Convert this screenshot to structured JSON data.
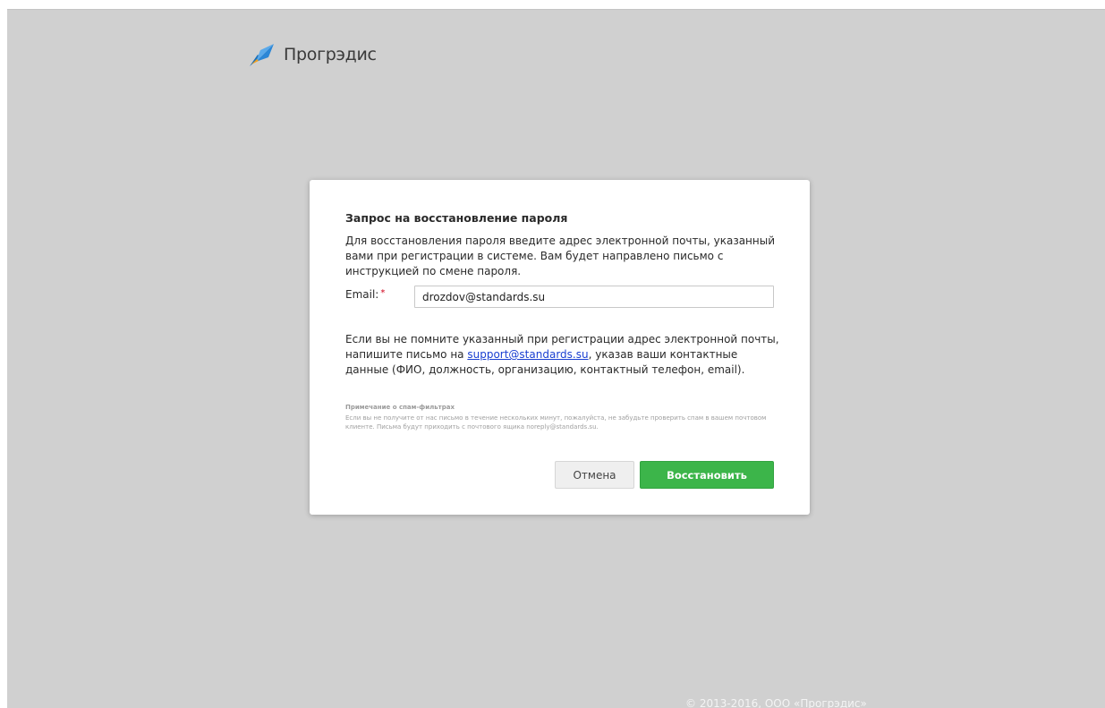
{
  "header": {
    "logo_text": "Прогрэдис"
  },
  "dialog": {
    "title": "Запрос на восстановление пароля",
    "description": "Для восстановления пароля введите адрес электронной почты, указанный вами при регистрации в системе. Вам будет направлено письмо с инструкцией по смене пароля.",
    "email_label": "Email:",
    "required_mark": "*",
    "email_value": "drozdov@standards.su",
    "help_prefix": "Если вы не помните указанный при регистрации адрес электронной почты, напишите письмо на ",
    "help_link": "support@standards.su",
    "help_suffix": ", указав ваши контактные данные (ФИО, должность, организацию, контактный телефон, email).",
    "spam_title": "Примечание о спам-фильтрах",
    "spam_text": "Если вы не получите от нас письмо в течение нескольких минут, пожалуйста, не забудьте проверить спам в вашем почтовом клиенте. Письма будут приходить с почтового ящика noreply@standards.su.",
    "cancel_label": "Отмена",
    "restore_label": "Восстановить"
  },
  "footer": {
    "copyright": "© 2013-2016, ООО «Прогрэдис»"
  },
  "colors": {
    "background": "#d0d0d0",
    "primary_button": "#3cb54a",
    "link": "#1a3fd1",
    "required": "#d0021b"
  },
  "icons": {
    "logo": "rocket-icon"
  }
}
